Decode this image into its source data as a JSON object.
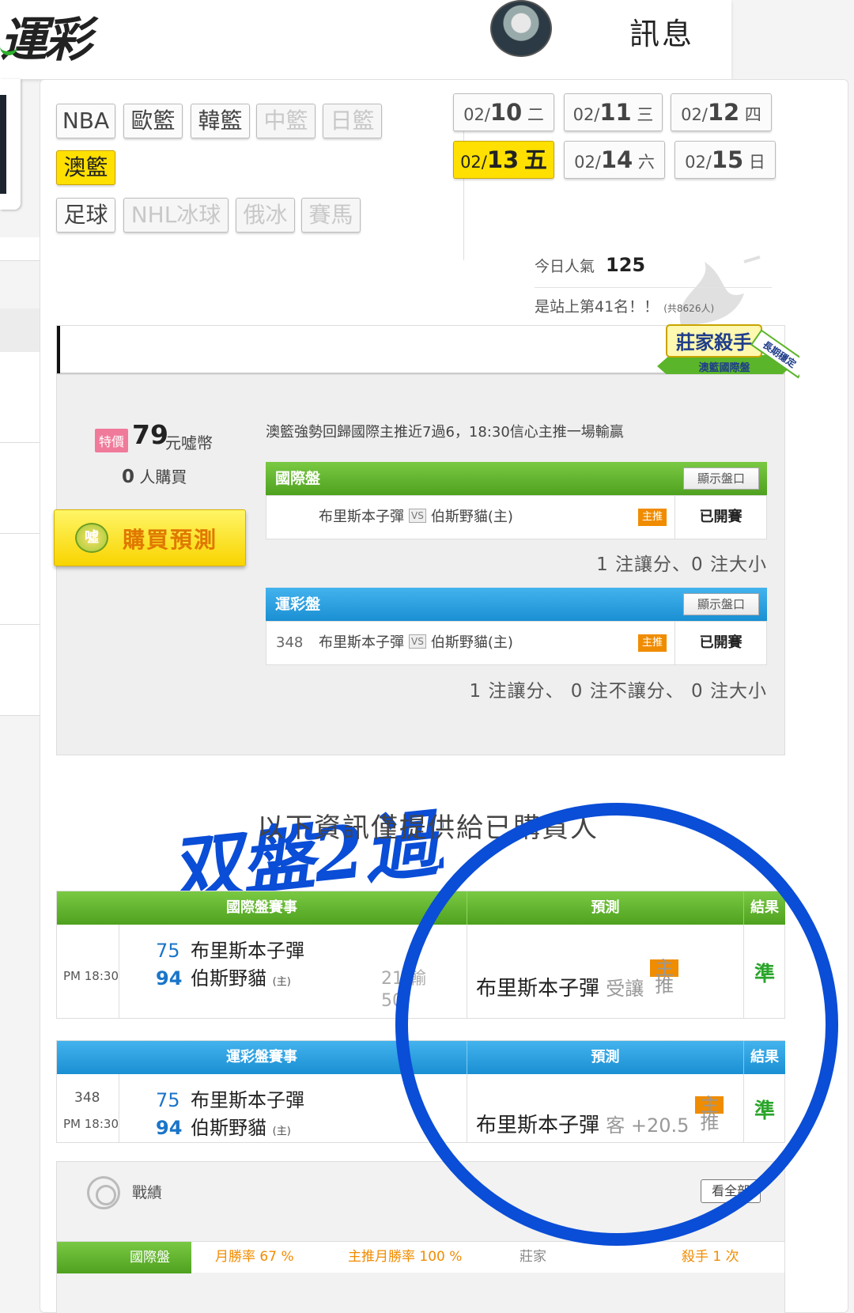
{
  "header": {
    "logo_text": "運彩",
    "message_label": "訊息"
  },
  "sports": [
    {
      "label": "NBA",
      "state": "normal"
    },
    {
      "label": "歐籃",
      "state": "normal"
    },
    {
      "label": "韓籃",
      "state": "normal"
    },
    {
      "label": "中籃",
      "state": "disabled"
    },
    {
      "label": "日籃",
      "state": "disabled"
    },
    {
      "label": "澳籃",
      "state": "active"
    },
    {
      "label": "足球",
      "state": "normal"
    },
    {
      "label": "NHL冰球",
      "state": "disabled"
    },
    {
      "label": "俄冰",
      "state": "disabled"
    },
    {
      "label": "賽馬",
      "state": "disabled"
    }
  ],
  "dates": [
    {
      "prefix": "02/",
      "day": "10",
      "weekday": "二",
      "active": false
    },
    {
      "prefix": "02/",
      "day": "11",
      "weekday": "三",
      "active": false
    },
    {
      "prefix": "02/",
      "day": "12",
      "weekday": "四",
      "active": false
    },
    {
      "prefix": "02/",
      "day": "13",
      "weekday": "五",
      "active": true
    },
    {
      "prefix": "02/",
      "day": "14",
      "weekday": "六",
      "active": false
    },
    {
      "prefix": "02/",
      "day": "15",
      "weekday": "日",
      "active": false
    }
  ],
  "popularity": {
    "label": "今日人氣",
    "value": "125",
    "rank_text": "是站上第41名！！",
    "rank_total": "(共8626人)"
  },
  "badge": {
    "title": "莊家殺手",
    "subtitle": "澳籃國際盤",
    "ribbon": "長期穩定"
  },
  "offer": {
    "special_tag": "特價",
    "price": "79",
    "price_unit": "元噓幣",
    "buyers_count": "0",
    "buyers_label": "人購買",
    "buy_icon": "噓",
    "buy_label": "購買預測",
    "description": "澳籃強勢回歸國際主推近7過6，18:30信心主推一場輸贏"
  },
  "intl_market": {
    "title": "國際盤",
    "show_label": "顯示盤口",
    "away": "布里斯本子彈",
    "vs": "VS",
    "home": "伯斯野貓(主)",
    "tag": "主推",
    "status": "已開賽",
    "counts": "1 注讓分、0 注大小"
  },
  "lottery_market": {
    "title": "運彩盤",
    "show_label": "顯示盤口",
    "game_no": "348",
    "away": "布里斯本子彈",
    "vs": "VS",
    "home": "伯斯野貓(主)",
    "tag": "主推",
    "status": "已開賽",
    "counts": "1 注讓分、 0 注不讓分、 0 注大小"
  },
  "handwriting": "双盤2過2",
  "notice": "以下資訊僅提供給已購買人",
  "intl_table": {
    "headers": [
      "國際盤賽事",
      "預測",
      "結果"
    ],
    "time": "PM 18:30",
    "away_score": "75",
    "away_team": "布里斯本子彈",
    "home_score": "94",
    "home_team": "伯斯野貓",
    "home_mark": "(主)",
    "line1": "21",
    "line1_result": "輸",
    "line2": "50",
    "pred_team": "布里斯本子彈",
    "pred_type": "受讓",
    "pred_tag": "主推",
    "result": "準"
  },
  "lottery_table": {
    "headers": [
      "運彩盤賽事",
      "預測",
      "結果"
    ],
    "game_no": "348",
    "time": "PM 18:30",
    "away_score": "75",
    "away_team": "布里斯本子彈",
    "home_score": "94",
    "home_team": "伯斯野貓",
    "home_mark": "(主)",
    "pred_team": "布里斯本子彈",
    "pred_type": "客 +20.5",
    "pred_tag": "主推",
    "result": "準"
  },
  "record": {
    "title": "戰績",
    "view_all": "看全部",
    "tag": "國際盤",
    "items": [
      "月勝率 67 %",
      "主推月勝率 100 %",
      "莊家",
      "殺手 1 次"
    ]
  },
  "colors": {
    "green_header": "#4ea11f",
    "blue_header": "#1a8fd2",
    "active_yellow": "#ffe000",
    "tag_orange": "#f08c00",
    "annotation_blue": "#0a4dd6"
  }
}
